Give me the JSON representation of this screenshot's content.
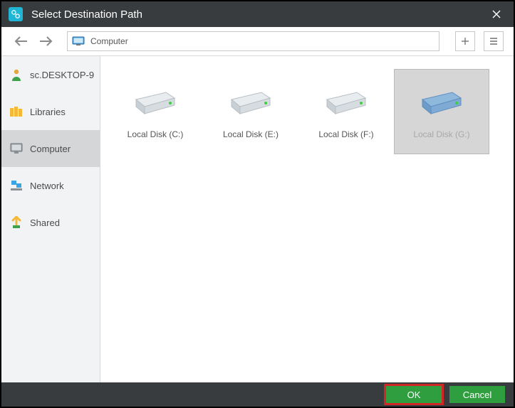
{
  "title": "Select Destination Path",
  "path_label": "Computer",
  "sidebar": {
    "items": [
      {
        "label": "sc.DESKTOP-9",
        "icon": "user"
      },
      {
        "label": "Libraries",
        "icon": "libraries"
      },
      {
        "label": "Computer",
        "icon": "computer",
        "selected": true
      },
      {
        "label": "Network",
        "icon": "network"
      },
      {
        "label": "Shared",
        "icon": "shared"
      }
    ]
  },
  "disks": [
    {
      "label": "Local Disk (C:)",
      "color": "gray"
    },
    {
      "label": "Local Disk (E:)",
      "color": "gray"
    },
    {
      "label": "Local Disk (F:)",
      "color": "gray"
    },
    {
      "label": "Local Disk (G:)",
      "color": "blue",
      "selected": true
    }
  ],
  "buttons": {
    "ok": "OK",
    "cancel": "Cancel"
  }
}
